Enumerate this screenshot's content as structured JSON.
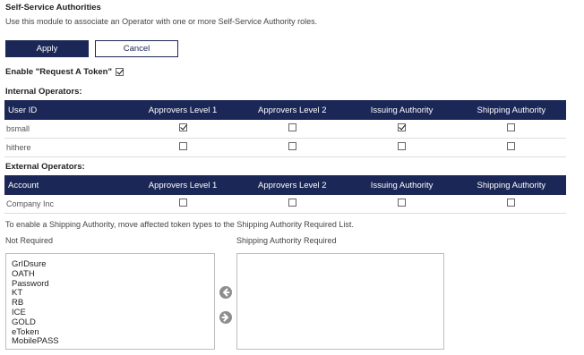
{
  "header": {
    "title": "Self-Service Authorities",
    "description": "Use this module to associate an Operator with one or more Self-Service Authority roles."
  },
  "buttons": {
    "apply": "Apply",
    "cancel": "Cancel"
  },
  "enable_token": {
    "label": "Enable \"Request A Token\"",
    "checked": true
  },
  "internal": {
    "label": "Internal Operators:",
    "columns": [
      "User ID",
      "Approvers Level 1",
      "Approvers Level 2",
      "Issuing Authority",
      "Shipping Authority"
    ],
    "rows": [
      {
        "name": "bsmall",
        "checks": [
          true,
          false,
          true,
          false
        ]
      },
      {
        "name": "hithere",
        "checks": [
          false,
          false,
          false,
          false
        ]
      }
    ]
  },
  "external": {
    "label": "External Operators:",
    "columns": [
      "Account",
      "Approvers Level 1",
      "Approvers Level 2",
      "Issuing Authority",
      "Shipping Authority"
    ],
    "rows": [
      {
        "name": "Company Inc",
        "checks": [
          false,
          false,
          false,
          false
        ]
      }
    ]
  },
  "shipping": {
    "info": "To enable a Shipping Authority, move affected token types to the Shipping Authority Required List.",
    "not_required_label": "Not Required",
    "required_label": "Shipping Authority Required",
    "not_required_items": [
      "GrIDsure",
      "OATH",
      "Password",
      "KT",
      "RB",
      "ICE",
      "GOLD",
      "eToken",
      "MobilePASS"
    ],
    "required_items": []
  },
  "icons": {
    "move_left": "arrow-left-circle-icon",
    "move_right": "arrow-right-circle-icon"
  },
  "colors": {
    "header_navy": "#1b2756",
    "arrow_gray": "#8e8e8e"
  }
}
